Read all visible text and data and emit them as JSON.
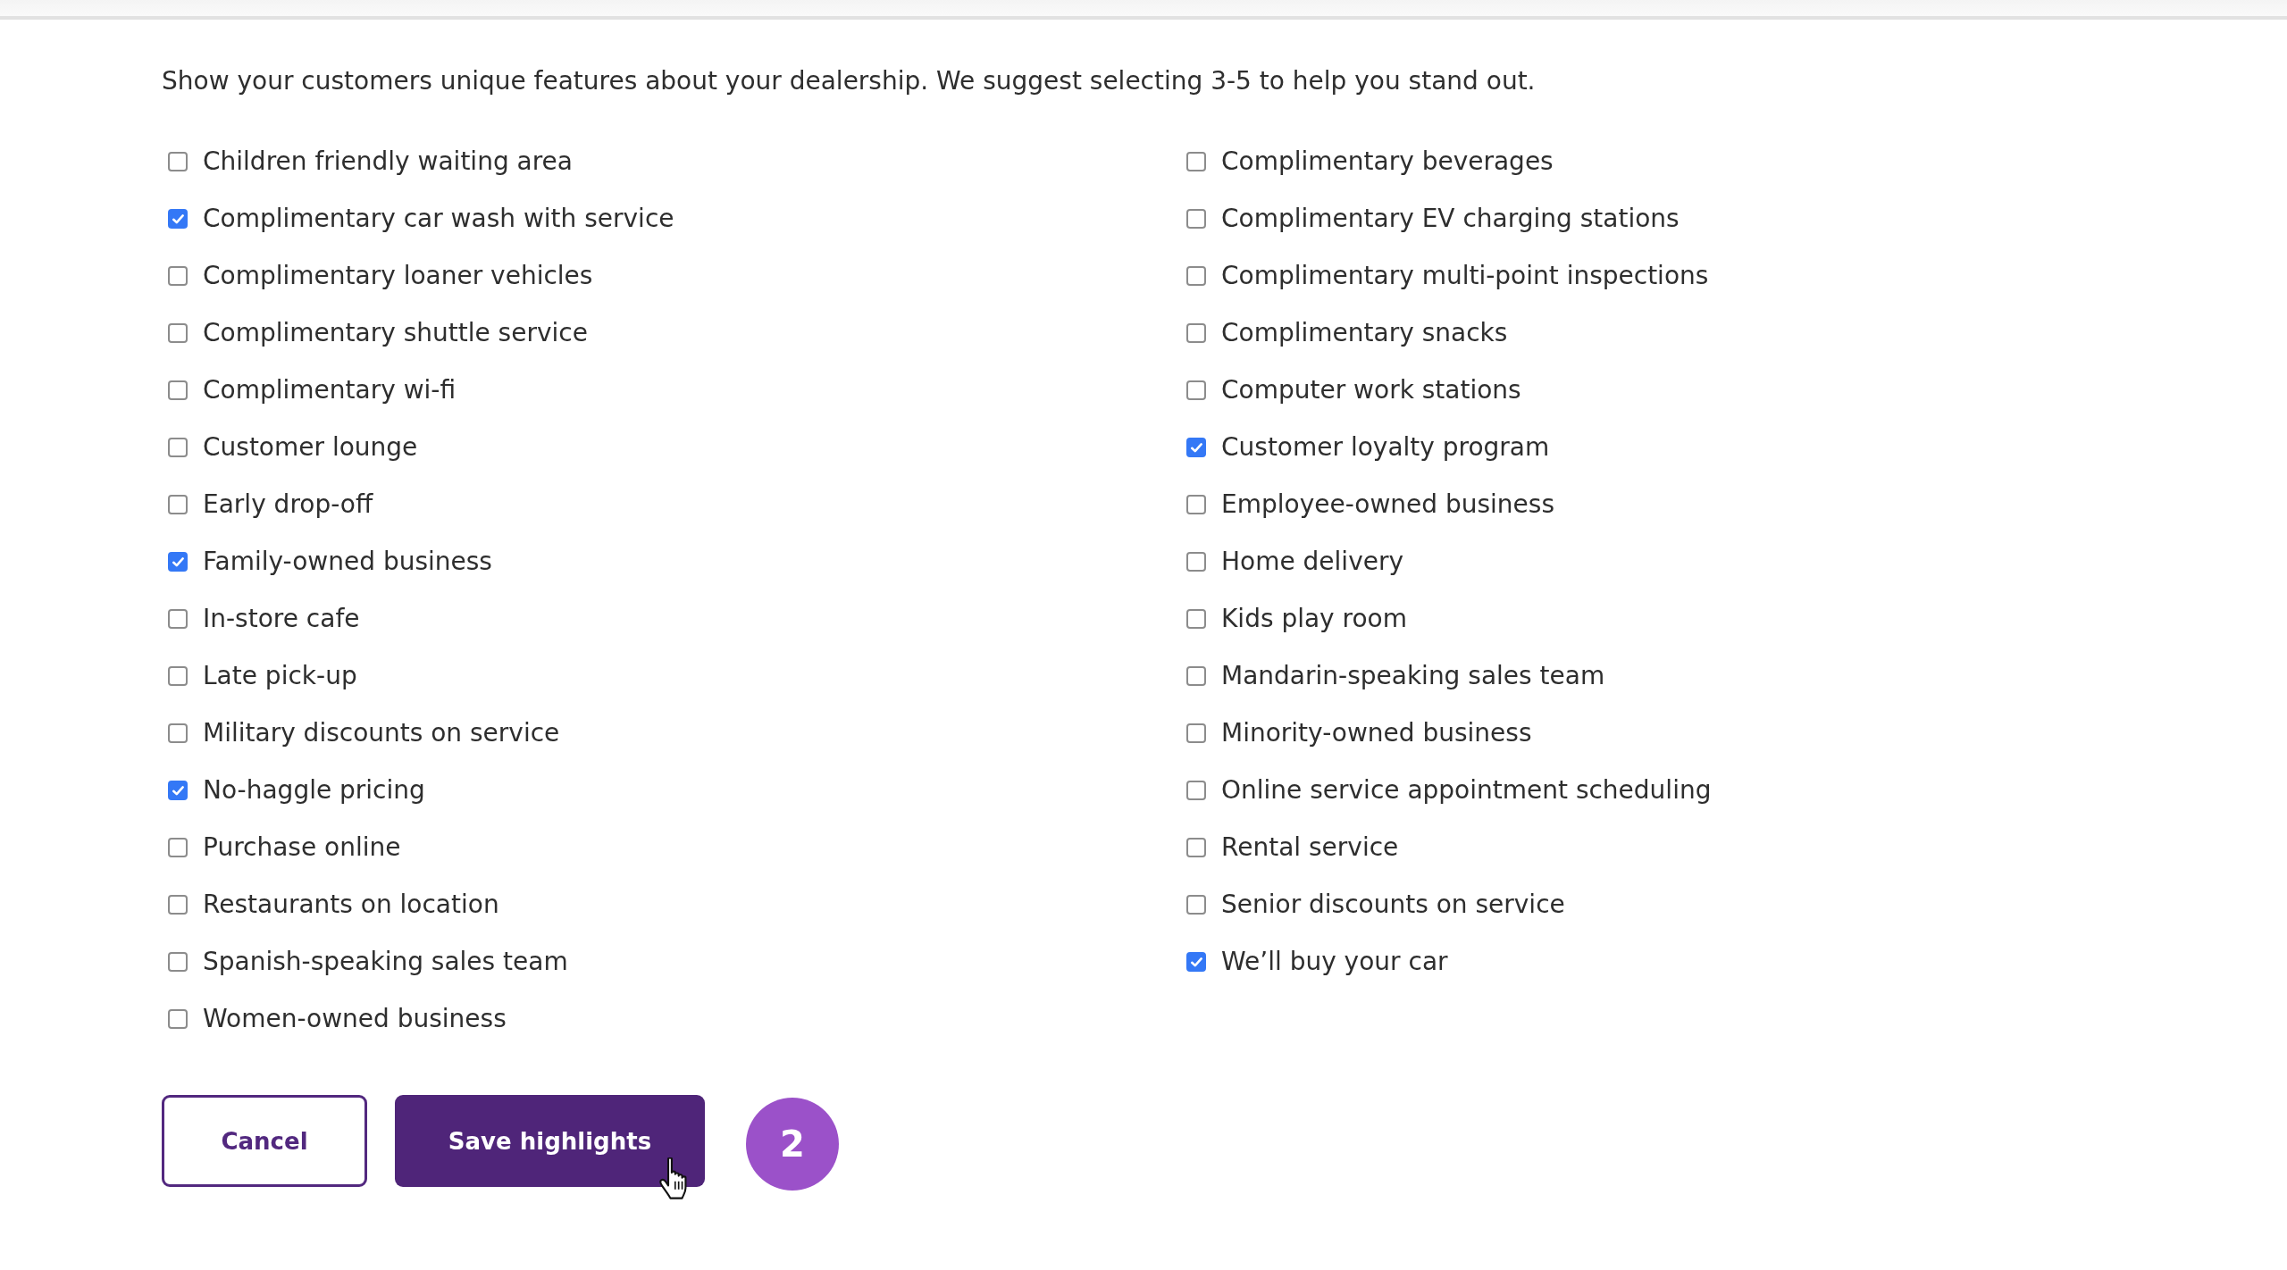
{
  "intro": "Show your customers unique features about your dealership. We suggest selecting 3-5 to help you stand out.",
  "highlights": [
    {
      "label": "Children friendly waiting area",
      "checked": false
    },
    {
      "label": "Complimentary beverages",
      "checked": false
    },
    {
      "label": "Complimentary car wash with service",
      "checked": true
    },
    {
      "label": "Complimentary EV charging stations",
      "checked": false
    },
    {
      "label": "Complimentary loaner vehicles",
      "checked": false
    },
    {
      "label": "Complimentary multi-point inspections",
      "checked": false
    },
    {
      "label": "Complimentary shuttle service",
      "checked": false
    },
    {
      "label": "Complimentary snacks",
      "checked": false
    },
    {
      "label": "Complimentary wi-fi",
      "checked": false
    },
    {
      "label": "Computer work stations",
      "checked": false
    },
    {
      "label": "Customer lounge",
      "checked": false
    },
    {
      "label": "Customer loyalty program",
      "checked": true
    },
    {
      "label": "Early drop-off",
      "checked": false
    },
    {
      "label": "Employee-owned business",
      "checked": false
    },
    {
      "label": "Family-owned business",
      "checked": true
    },
    {
      "label": "Home delivery",
      "checked": false
    },
    {
      "label": "In-store cafe",
      "checked": false
    },
    {
      "label": "Kids play room",
      "checked": false
    },
    {
      "label": "Late pick-up",
      "checked": false
    },
    {
      "label": "Mandarin-speaking sales team",
      "checked": false
    },
    {
      "label": "Military discounts on service",
      "checked": false
    },
    {
      "label": "Minority-owned business",
      "checked": false
    },
    {
      "label": "No-haggle pricing",
      "checked": true
    },
    {
      "label": "Online service appointment scheduling",
      "checked": false
    },
    {
      "label": "Purchase online",
      "checked": false
    },
    {
      "label": "Rental service",
      "checked": false
    },
    {
      "label": "Restaurants on location",
      "checked": false
    },
    {
      "label": "Senior discounts on service",
      "checked": false
    },
    {
      "label": "Spanish-speaking sales team",
      "checked": false
    },
    {
      "label": "We’ll buy your car",
      "checked": true
    },
    {
      "label": "Women-owned business",
      "checked": false
    }
  ],
  "buttons": [
    {
      "label": "Cancel",
      "kind": "secondary"
    },
    {
      "label": "Save highlights",
      "kind": "primary"
    }
  ],
  "step_badge": "2"
}
